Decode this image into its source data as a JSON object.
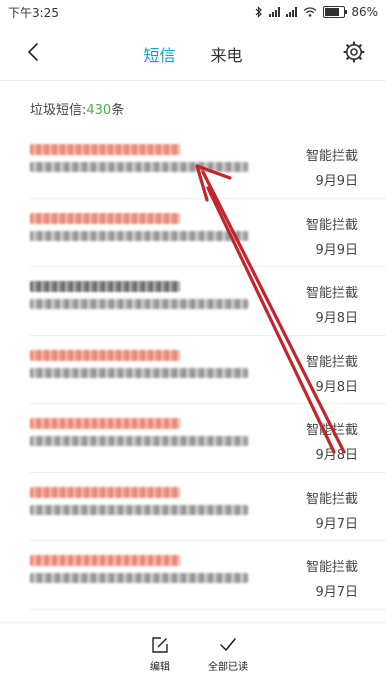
{
  "status_bar": {
    "time": "下午3:25",
    "battery_text": "86%",
    "battery_level": 0.86,
    "icons": [
      "bluetooth-icon",
      "signal-icon",
      "wifi-icon",
      "battery-icon"
    ]
  },
  "header": {
    "tabs": [
      {
        "label": "短信",
        "active": true
      },
      {
        "label": "来电",
        "active": false
      }
    ],
    "icons": [
      "back-arrow-icon",
      "gear-icon"
    ]
  },
  "summary": {
    "label": "垃圾短信:",
    "count": "430",
    "unit": "条"
  },
  "messages": [
    {
      "tag": "智能拦截",
      "date": "9月9日",
      "sender_style": "red"
    },
    {
      "tag": "智能拦截",
      "date": "9月9日",
      "sender_style": "red"
    },
    {
      "tag": "智能拦截",
      "date": "9月8日",
      "sender_style": "dark"
    },
    {
      "tag": "智能拦截",
      "date": "9月8日",
      "sender_style": "red"
    },
    {
      "tag": "智能拦截",
      "date": "9月8日",
      "sender_style": "red"
    },
    {
      "tag": "智能拦截",
      "date": "9月7日",
      "sender_style": "red"
    },
    {
      "tag": "智能拦截",
      "date": "9月7日",
      "sender_style": "red"
    }
  ],
  "bottom_bar": {
    "edit_label": "编辑",
    "mark_all_read_label": "全部已读"
  },
  "colors": {
    "accent": "#1a97d5",
    "count_green": "#4caf50",
    "annotation_red": "#c0262c"
  }
}
